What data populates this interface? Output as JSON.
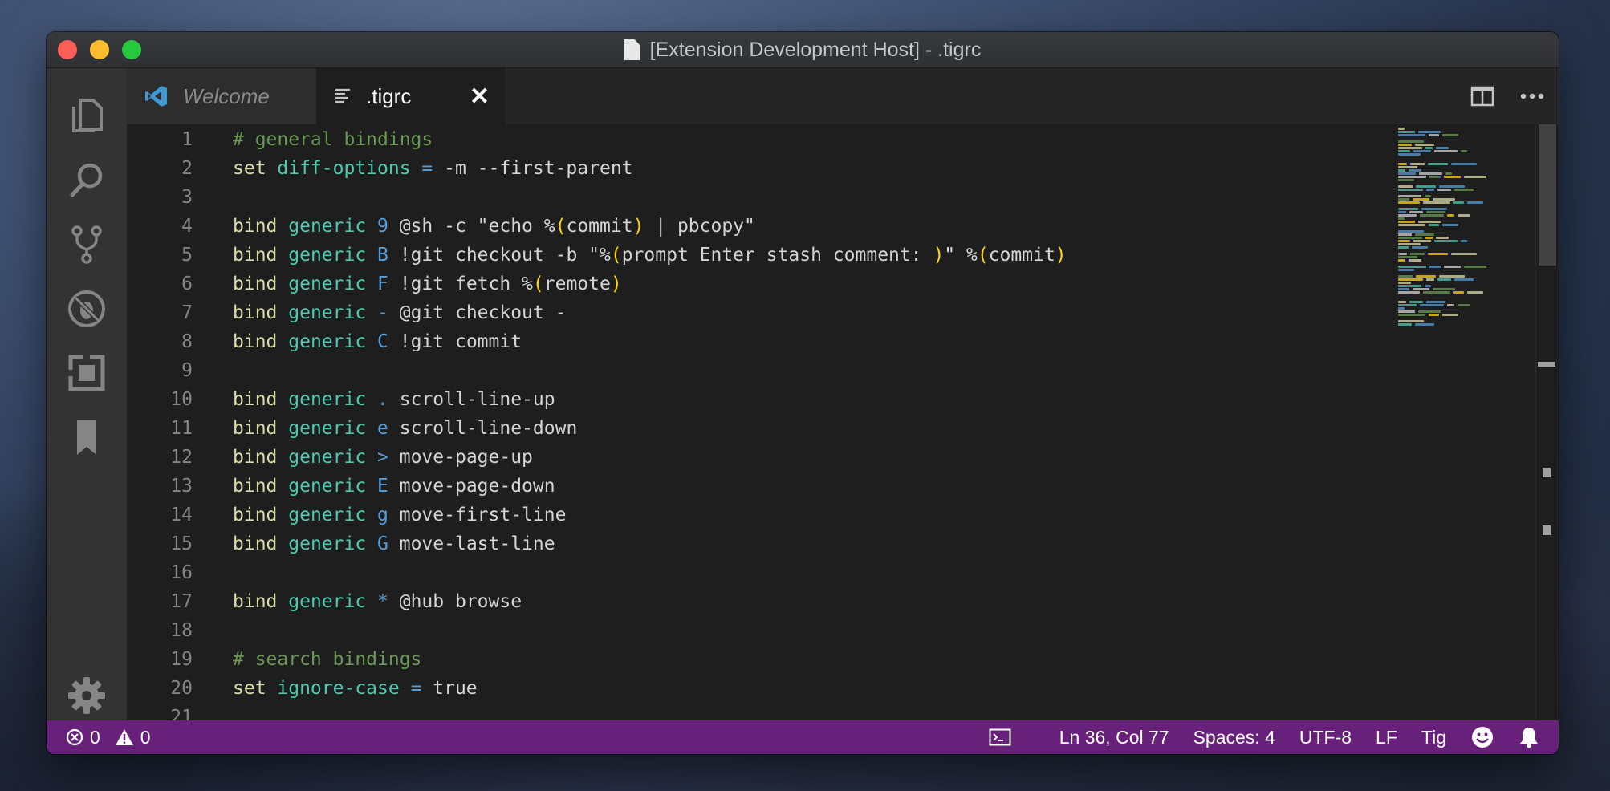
{
  "window": {
    "title": "[Extension Development Host] - .tigrc"
  },
  "tabs": [
    {
      "label": "Welcome",
      "active": false
    },
    {
      "label": ".tigrc",
      "active": true,
      "close_glyph": "✕"
    }
  ],
  "editor": {
    "lines": [
      {
        "num": "1",
        "segments": [
          {
            "t": "# general bindings",
            "c": "comment"
          }
        ]
      },
      {
        "num": "2",
        "segments": [
          {
            "t": "set ",
            "c": "kw"
          },
          {
            "t": "diff-options",
            "c": "opt"
          },
          {
            "t": " = ",
            "c": "key"
          },
          {
            "t": "-m --first-parent",
            "c": "plain"
          }
        ]
      },
      {
        "num": "3",
        "segments": []
      },
      {
        "num": "4",
        "segments": [
          {
            "t": "bind ",
            "c": "kw"
          },
          {
            "t": "generic ",
            "c": "opt"
          },
          {
            "t": "9 ",
            "c": "key"
          },
          {
            "t": "@sh -c \"echo %",
            "c": "plain"
          },
          {
            "t": "(",
            "c": "paren"
          },
          {
            "t": "commit",
            "c": "plain"
          },
          {
            "t": ")",
            "c": "paren"
          },
          {
            "t": " | pbcopy\"",
            "c": "plain"
          }
        ]
      },
      {
        "num": "5",
        "segments": [
          {
            "t": "bind ",
            "c": "kw"
          },
          {
            "t": "generic ",
            "c": "opt"
          },
          {
            "t": "B ",
            "c": "key"
          },
          {
            "t": "!git checkout -b \"%",
            "c": "plain"
          },
          {
            "t": "(",
            "c": "paren"
          },
          {
            "t": "prompt Enter stash comment: ",
            "c": "plain"
          },
          {
            "t": ")",
            "c": "paren"
          },
          {
            "t": "\" %",
            "c": "plain"
          },
          {
            "t": "(",
            "c": "paren"
          },
          {
            "t": "commit",
            "c": "plain"
          },
          {
            "t": ")",
            "c": "paren"
          }
        ]
      },
      {
        "num": "6",
        "segments": [
          {
            "t": "bind ",
            "c": "kw"
          },
          {
            "t": "generic ",
            "c": "opt"
          },
          {
            "t": "F ",
            "c": "key"
          },
          {
            "t": "!git fetch %",
            "c": "plain"
          },
          {
            "t": "(",
            "c": "paren"
          },
          {
            "t": "remote",
            "c": "plain"
          },
          {
            "t": ")",
            "c": "paren"
          }
        ]
      },
      {
        "num": "7",
        "segments": [
          {
            "t": "bind ",
            "c": "kw"
          },
          {
            "t": "generic ",
            "c": "opt"
          },
          {
            "t": "- ",
            "c": "key"
          },
          {
            "t": "@git checkout -",
            "c": "plain"
          }
        ]
      },
      {
        "num": "8",
        "segments": [
          {
            "t": "bind ",
            "c": "kw"
          },
          {
            "t": "generic ",
            "c": "opt"
          },
          {
            "t": "C ",
            "c": "key"
          },
          {
            "t": "!git commit",
            "c": "plain"
          }
        ]
      },
      {
        "num": "9",
        "segments": []
      },
      {
        "num": "10",
        "segments": [
          {
            "t": "bind ",
            "c": "kw"
          },
          {
            "t": "generic ",
            "c": "opt"
          },
          {
            "t": ". ",
            "c": "key"
          },
          {
            "t": "scroll-line-up",
            "c": "plain"
          }
        ]
      },
      {
        "num": "11",
        "segments": [
          {
            "t": "bind ",
            "c": "kw"
          },
          {
            "t": "generic ",
            "c": "opt"
          },
          {
            "t": "e ",
            "c": "key"
          },
          {
            "t": "scroll-line-down",
            "c": "plain"
          }
        ]
      },
      {
        "num": "12",
        "segments": [
          {
            "t": "bind ",
            "c": "kw"
          },
          {
            "t": "generic ",
            "c": "opt"
          },
          {
            "t": "> ",
            "c": "key"
          },
          {
            "t": "move-page-up",
            "c": "plain"
          }
        ]
      },
      {
        "num": "13",
        "segments": [
          {
            "t": "bind ",
            "c": "kw"
          },
          {
            "t": "generic ",
            "c": "opt"
          },
          {
            "t": "E ",
            "c": "key"
          },
          {
            "t": "move-page-down",
            "c": "plain"
          }
        ]
      },
      {
        "num": "14",
        "segments": [
          {
            "t": "bind ",
            "c": "kw"
          },
          {
            "t": "generic ",
            "c": "opt"
          },
          {
            "t": "g ",
            "c": "key"
          },
          {
            "t": "move-first-line",
            "c": "plain"
          }
        ]
      },
      {
        "num": "15",
        "segments": [
          {
            "t": "bind ",
            "c": "kw"
          },
          {
            "t": "generic ",
            "c": "opt"
          },
          {
            "t": "G ",
            "c": "key"
          },
          {
            "t": "move-last-line",
            "c": "plain"
          }
        ]
      },
      {
        "num": "16",
        "segments": []
      },
      {
        "num": "17",
        "segments": [
          {
            "t": "bind ",
            "c": "kw"
          },
          {
            "t": "generic ",
            "c": "opt"
          },
          {
            "t": "* ",
            "c": "key"
          },
          {
            "t": "@hub browse",
            "c": "plain"
          }
        ]
      },
      {
        "num": "18",
        "segments": []
      },
      {
        "num": "19",
        "segments": [
          {
            "t": "# search bindings",
            "c": "comment"
          }
        ]
      },
      {
        "num": "20",
        "segments": [
          {
            "t": "set ",
            "c": "kw"
          },
          {
            "t": "ignore-case",
            "c": "opt"
          },
          {
            "t": " = ",
            "c": "key"
          },
          {
            "t": "true",
            "c": "plain"
          }
        ]
      },
      {
        "num": "21",
        "segments": []
      }
    ]
  },
  "statusbar": {
    "errors": "0",
    "warnings": "0",
    "cursor": "Ln 36, Col 77",
    "indent": "Spaces: 4",
    "encoding": "UTF-8",
    "eol": "LF",
    "language": "Tig"
  },
  "colors": {
    "statusbar_bg": "#68217a",
    "comment": "#6a9955",
    "keyword": "#dcdcaa",
    "option": "#4ec9b0",
    "key": "#569cd6",
    "paren": "#ffd700"
  },
  "icons": [
    "files-icon",
    "search-icon",
    "source-control-icon",
    "debug-icon",
    "extensions-icon",
    "bookmark-icon",
    "settings-gear-icon",
    "split-editor-icon",
    "more-actions-icon",
    "terminal-icon",
    "feedback-smiley-icon",
    "notifications-bell-icon",
    "error-icon",
    "warning-icon",
    "vscode-logo-icon",
    "file-lines-icon"
  ]
}
